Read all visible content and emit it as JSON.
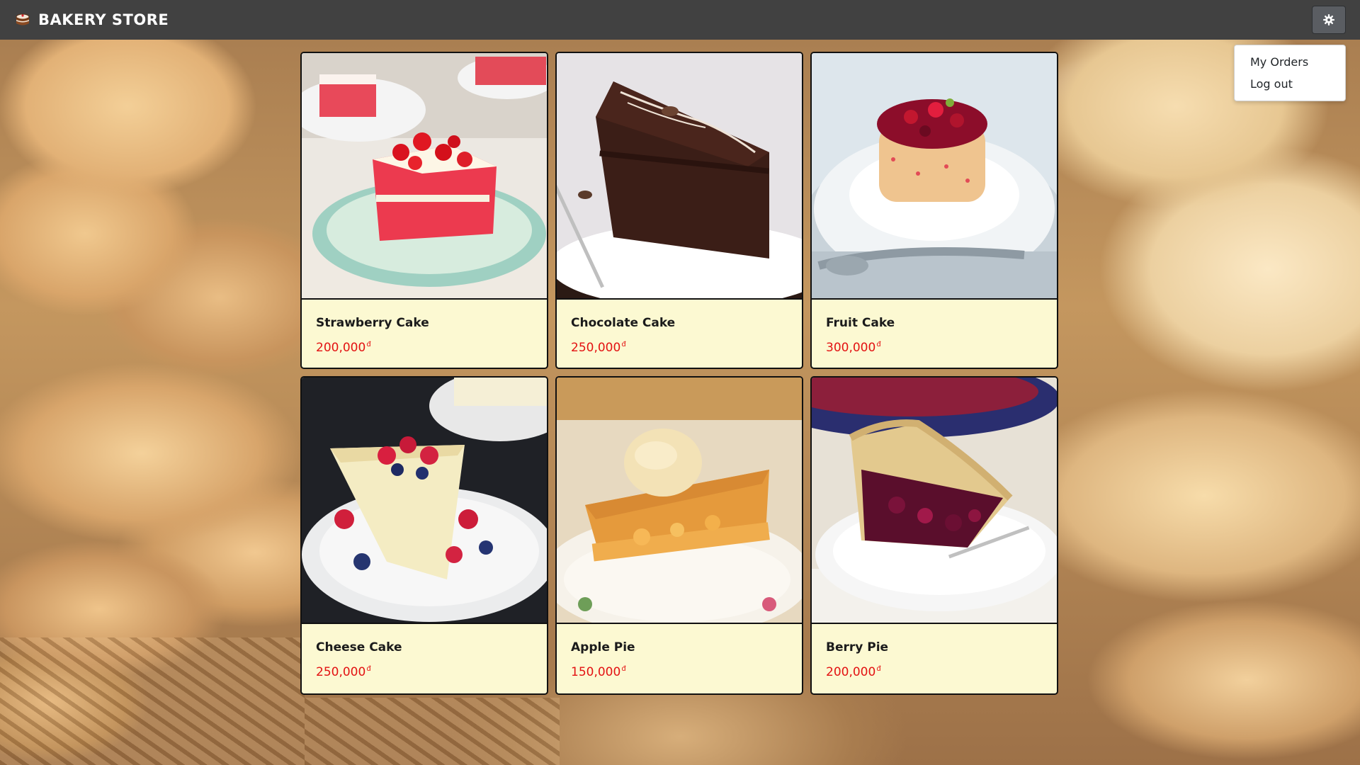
{
  "app": {
    "brand_name": "BAKERY STORE",
    "brand_icon": "cake-icon"
  },
  "settings": {
    "icon": "gear-icon"
  },
  "menu": {
    "items": [
      {
        "label": "My Orders"
      },
      {
        "label": "Log out"
      }
    ]
  },
  "products": [
    {
      "name": "Strawberry Cake",
      "price": "200,000",
      "currency": "đ",
      "image": "strawberry-cake-photo"
    },
    {
      "name": "Chocolate Cake",
      "price": "250,000",
      "currency": "đ",
      "image": "chocolate-cake-photo"
    },
    {
      "name": "Fruit Cake",
      "price": "300,000",
      "currency": "đ",
      "image": "fruit-cake-photo"
    },
    {
      "name": "Cheese Cake",
      "price": "250,000",
      "currency": "đ",
      "image": "cheese-cake-photo"
    },
    {
      "name": "Apple Pie",
      "price": "150,000",
      "currency": "đ",
      "image": "apple-pie-photo"
    },
    {
      "name": "Berry Pie",
      "price": "200,000",
      "currency": "đ",
      "image": "berry-pie-photo"
    }
  ],
  "colors": {
    "navbar": "#414141",
    "card_background": "#fcf9d2",
    "price": "#e31212"
  }
}
